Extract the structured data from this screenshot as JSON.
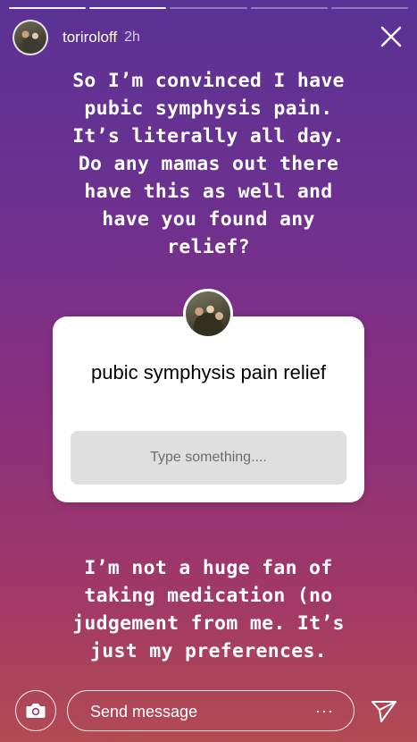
{
  "story": {
    "progress_segments": 5,
    "progress_completed": 2,
    "username": "toriroloff",
    "timestamp": "2h"
  },
  "caption_top": "So I’m convinced I have\npubic symphysis pain.\nIt’s literally all day.\nDo any mamas out there\nhave this as well and\nhave you found any\nrelief?",
  "question_sticker": {
    "title": "pubic symphysis pain relief",
    "placeholder": "Type something...."
  },
  "caption_bottom": "I’m not a huge fan of\ntaking medication (no\njudgement from me. It’s\njust my preferences.",
  "footer": {
    "message_placeholder": "Send message",
    "more_label": "···"
  },
  "icons": {
    "close": "close-icon",
    "camera": "camera-icon",
    "send": "send-icon"
  }
}
